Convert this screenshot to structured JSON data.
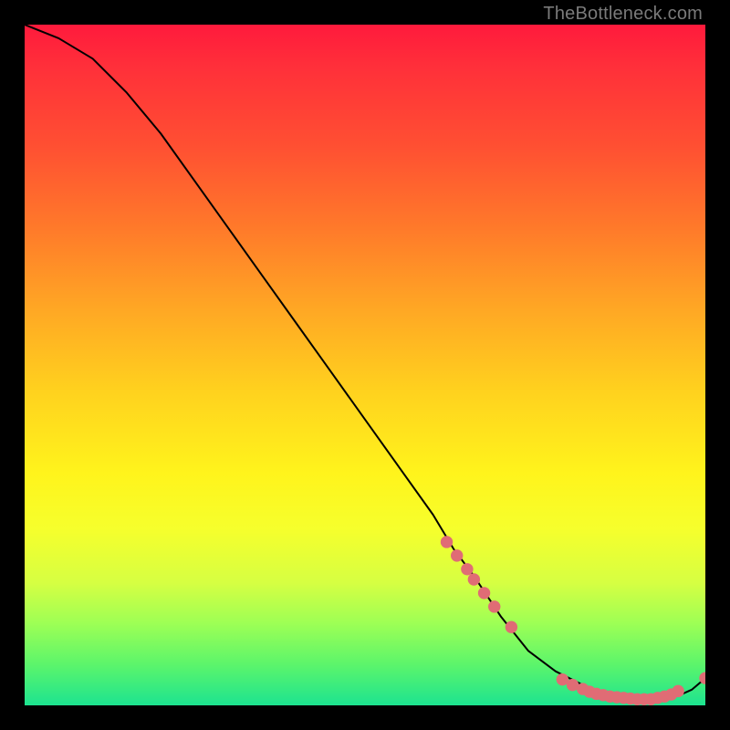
{
  "watermark": "TheBottleneck.com",
  "chart_data": {
    "type": "line",
    "title": "",
    "xlabel": "",
    "ylabel": "",
    "xlim": [
      0,
      100
    ],
    "ylim": [
      0,
      100
    ],
    "series": [
      {
        "name": "curve",
        "x": [
          0,
          5,
          10,
          15,
          20,
          25,
          30,
          35,
          40,
          45,
          50,
          55,
          60,
          63,
          66,
          70,
          74,
          78,
          82,
          86,
          88,
          90,
          92,
          94,
          96,
          98,
          100
        ],
        "y": [
          100,
          98,
          95,
          90,
          84,
          77,
          70,
          63,
          56,
          49,
          42,
          35,
          28,
          23,
          19,
          13,
          8,
          5,
          3,
          1.5,
          1.0,
          0.8,
          0.8,
          1.0,
          1.4,
          2.3,
          4.0
        ]
      }
    ],
    "markers": {
      "name": "points",
      "color": "#e06c75",
      "radius_norm": 0.009,
      "x": [
        62,
        63.5,
        65,
        66,
        67.5,
        69,
        71.5,
        79,
        80.5,
        82,
        83,
        84,
        85,
        86,
        87,
        88,
        89,
        90,
        91,
        92,
        93,
        94,
        95,
        96,
        100
      ],
      "y": [
        24,
        22,
        20,
        18.5,
        16.5,
        14.5,
        11.5,
        3.8,
        3.0,
        2.4,
        2.0,
        1.7,
        1.5,
        1.3,
        1.2,
        1.1,
        1.0,
        0.9,
        0.9,
        0.9,
        1.1,
        1.3,
        1.6,
        2.1,
        4.0
      ]
    },
    "colors": {
      "line": "#000000",
      "marker": "#e06c75",
      "background_top": "#ff1a3c",
      "background_bottom": "#1de390",
      "frame": "#000000"
    }
  }
}
